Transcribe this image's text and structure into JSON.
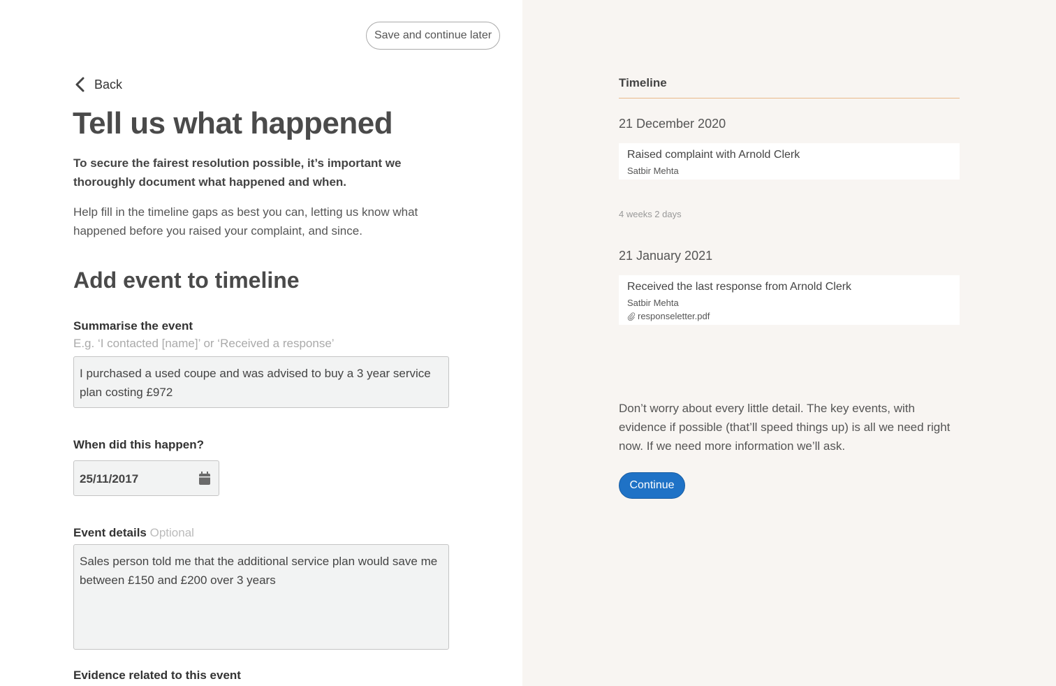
{
  "header": {
    "save_label": "Save and continue later"
  },
  "nav": {
    "back_label": "Back"
  },
  "page": {
    "title": "Tell us what happened",
    "intro_bold": "To secure the fairest resolution possible, it’s important we thoroughly document what happened and when.",
    "intro": "Help fill in the timeline gaps as best you can, letting us know what happened before you raised your complaint, and since."
  },
  "form": {
    "section_title": "Add event to timeline",
    "summary": {
      "label": "Summarise the event",
      "hint": "E.g. ‘I contacted [name]’ or ‘Received a response’",
      "value": "I purchased a used coupe and was advised to buy a 3 year service plan costing £972"
    },
    "date": {
      "label": "When did this happen?",
      "value": "25/11/2017"
    },
    "details": {
      "label": "Event details",
      "optional": "Optional",
      "value": "Sales person told me that the additional service plan would save me between £150 and £200 over 3 years"
    },
    "evidence": {
      "label": "Evidence related to this event"
    }
  },
  "timeline": {
    "title": "Timeline",
    "events": [
      {
        "date": "21 December 2020",
        "title": "Raised complaint with Arnold Clerk",
        "person": "Satbir Mehta"
      },
      {
        "date": "21 January 2021",
        "title": "Received the last response from Arnold Clerk",
        "person": "Satbir Mehta",
        "attachment": "responseletter.pdf"
      }
    ],
    "gap_label": "4 weeks 2 days",
    "note": "Don’t worry about every little detail. The key events, with evidence if possible (that’ll speed things up) is all we need right now. If we need more information we’ll ask.",
    "continue_label": "Continue"
  },
  "colors": {
    "accent": "#1f72c6",
    "rule": "#e8b98a",
    "panel_bg": "#f8f5f2"
  }
}
